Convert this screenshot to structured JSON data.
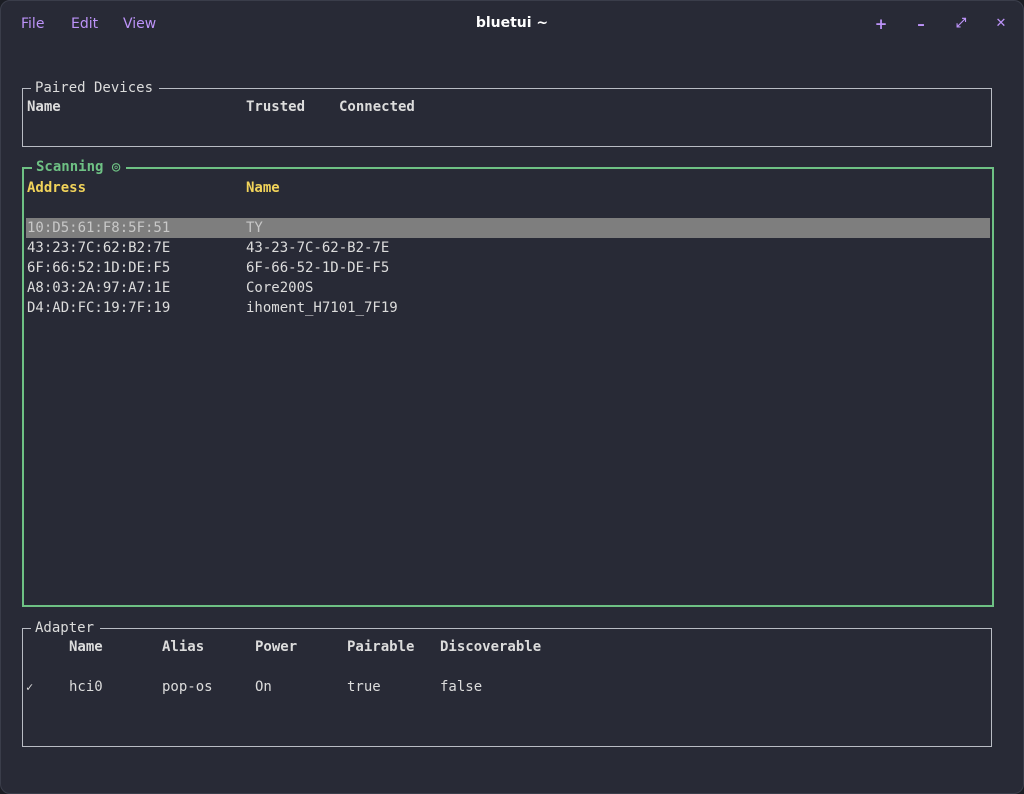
{
  "window": {
    "title": "bluetui ~",
    "menu": [
      "File",
      "Edit",
      "View"
    ],
    "controls": [
      "+",
      "–",
      "⤢",
      "✕"
    ]
  },
  "paired": {
    "title": "Paired Devices",
    "headers": [
      "Name",
      "Trusted",
      "Connected"
    ]
  },
  "scanning": {
    "title": "Scanning ◎",
    "headers": [
      "Address",
      "Name"
    ],
    "rows": [
      {
        "address": "10:D5:61:F8:5F:51",
        "name": "TY",
        "selected": true
      },
      {
        "address": "43:23:7C:62:B2:7E",
        "name": "43-23-7C-62-B2-7E"
      },
      {
        "address": "6F:66:52:1D:DE:F5",
        "name": "6F-66-52-1D-DE-F5"
      },
      {
        "address": "A8:03:2A:97:A7:1E",
        "name": "Core200S"
      },
      {
        "address": "D4:AD:FC:19:7F:19",
        "name": "ihoment_H7101_7F19"
      }
    ]
  },
  "adapter": {
    "title": "Adapter",
    "headers": [
      "Name",
      "Alias",
      "Power",
      "Pairable",
      "Discoverable"
    ],
    "row": {
      "check": "✓",
      "name": "hci0",
      "alias": "pop-os",
      "power": "On",
      "pairable": "true",
      "discoverable": "false"
    }
  },
  "colors": {
    "accent": "#bd93f9",
    "focus_border": "#6ec184",
    "header_yellow": "#f1d35a",
    "selection": "#7e7e7e",
    "background": "#282a36"
  }
}
